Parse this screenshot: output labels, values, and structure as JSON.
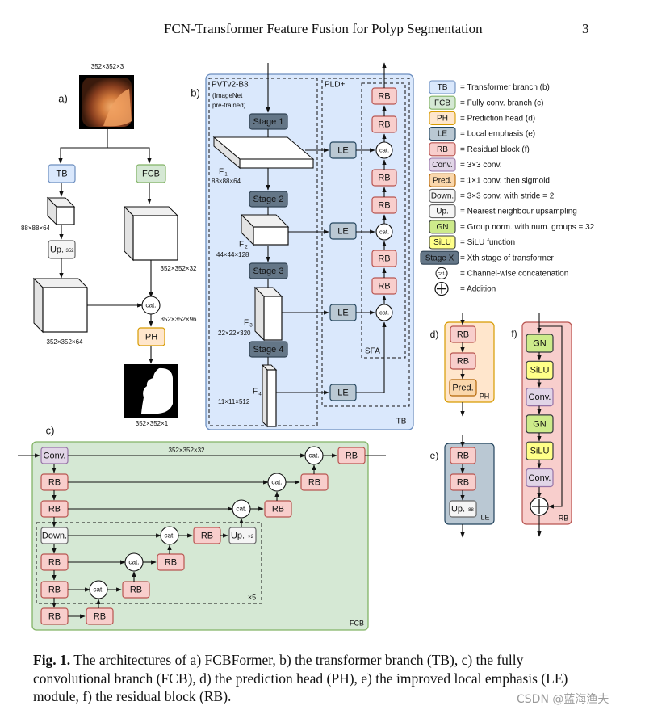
{
  "header": {
    "running_title": "FCN-Transformer Feature Fusion for Polyp Segmentation",
    "page_number": "3"
  },
  "colors": {
    "tb": "#dae8fc",
    "tb_border": "#6c8ebf",
    "fcb": "#d5e8d4",
    "fcb_border": "#82b366",
    "ph": "#ffe6cc",
    "ph_border": "#d79b00",
    "le": "#bac8d3",
    "le_border": "#23445d",
    "rb": "#f8cecc",
    "rb_border": "#b85450",
    "conv": "#e1d5e7",
    "conv_border": "#9673a6",
    "pred": "#fad7ac",
    "pred_border": "#b46504",
    "down": "#f5f5f5",
    "down_border": "#666666",
    "gn": "#cdeb8b",
    "gn_border": "#36393d",
    "silu": "#ffff88",
    "silu_border": "#36393d",
    "stage": "#647687",
    "stage_border": "#314354"
  },
  "panel_a": {
    "label": "a)",
    "input_dims": "352×352×3",
    "tb_label": "TB",
    "fcb_label": "FCB",
    "tb_out_dims": "88×88×64",
    "up_label": "Up.",
    "up_sub": "352",
    "fcb_out_dims": "352×352×32",
    "up_out_dims": "352×352×64",
    "cat_label": "cat.",
    "cat_out_dims": "352×352×96",
    "ph_label": "PH",
    "output_dims": "352×352×1"
  },
  "panel_b": {
    "label": "b)",
    "encoder_title": "PVTv2-B3",
    "encoder_note1": "(ImageNet",
    "encoder_note2": "pre-trained)",
    "decoder_title": "PLD+",
    "sfa_label": "SFA",
    "tb_corner": "TB",
    "stages": [
      "Stage 1",
      "Stage 2",
      "Stage 3",
      "Stage 4"
    ],
    "features": [
      {
        "name": "F",
        "sub": "1",
        "dims": "88×88×64"
      },
      {
        "name": "F",
        "sub": "2",
        "dims": "44×44×128"
      },
      {
        "name": "F",
        "sub": "3",
        "dims": "22×22×320"
      },
      {
        "name": "F",
        "sub": "4",
        "dims": "11×11×512"
      }
    ],
    "le_label": "LE",
    "rb_label": "RB",
    "cat_label": "cat."
  },
  "panel_c": {
    "label": "c)",
    "conv_label": "Conv.",
    "top_dims": "352×352×32",
    "rb_label": "RB",
    "cat_label": "cat.",
    "down_label": "Down.",
    "up_label": "Up.",
    "up_sub": "×2",
    "repeat": "×5",
    "corner": "FCB"
  },
  "panel_d": {
    "label": "d)",
    "rb": "RB",
    "pred": "Pred.",
    "corner": "PH"
  },
  "panel_e": {
    "label": "e)",
    "rb": "RB",
    "up": "Up.",
    "up_sub": "88",
    "corner": "LE"
  },
  "panel_f": {
    "label": "f)",
    "gn": "GN",
    "silu": "SiLU",
    "conv": "Conv.",
    "corner": "RB"
  },
  "legend": [
    {
      "key": "TB",
      "kind": "tb",
      "desc": "= Transformer branch (b)"
    },
    {
      "key": "FCB",
      "kind": "fcb",
      "desc": "= Fully conv. branch (c)"
    },
    {
      "key": "PH",
      "kind": "ph",
      "desc": "= Prediction head (d)"
    },
    {
      "key": "LE",
      "kind": "le",
      "desc": "= Local emphasis (e)"
    },
    {
      "key": "RB",
      "kind": "rb",
      "desc": "= Residual block (f)"
    },
    {
      "key": "Conv.",
      "kind": "conv",
      "desc": "= 3×3 conv."
    },
    {
      "key": "Pred.",
      "kind": "pred",
      "desc": "= 1×1 conv. then sigmoid"
    },
    {
      "key": "Down.",
      "kind": "down",
      "desc": "= 3×3 conv. with stride = 2"
    },
    {
      "key": "Up.",
      "kind": "down",
      "desc": "= Nearest neighbour upsampling"
    },
    {
      "key": "GN",
      "kind": "gn",
      "desc": "= Group norm. with num. groups = 32"
    },
    {
      "key": "SiLU",
      "kind": "silu",
      "desc": "= SiLU function"
    },
    {
      "key": "Stage X",
      "kind": "stage",
      "desc": "= Xth stage of transformer"
    },
    {
      "key": "cat.",
      "kind": "cat",
      "desc": "= Channel-wise concatenation"
    },
    {
      "key": "+",
      "kind": "add",
      "desc": "= Addition"
    }
  ],
  "caption": {
    "label": "Fig. 1.",
    "text": "The architectures of a) FCBFormer, b) the transformer branch (TB), c) the fully convolutional branch (FCB), d) the prediction head (PH), e) the improved local emphasis (LE) module, f) the residual block (RB)."
  },
  "watermark": "CSDN @蓝海渔夫"
}
